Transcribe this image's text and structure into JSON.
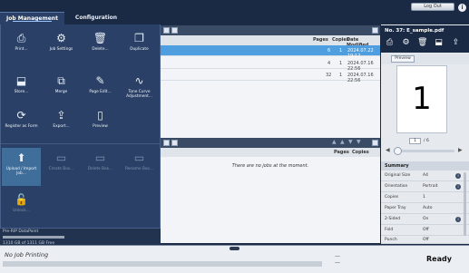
{
  "header": {
    "tabs": [
      {
        "label": "Job Management"
      },
      {
        "label": "Configuration"
      }
    ],
    "logout_label": "Log Out",
    "info_icon": "i"
  },
  "job_list": {
    "columns": {
      "pages": "Pages",
      "copies": "Copies",
      "date_modified": "Date Modified"
    },
    "rows": [
      {
        "pages": "6",
        "copies": "1",
        "date": "2024.07.22 19:12",
        "selected": true
      },
      {
        "pages": "4",
        "copies": "1",
        "date": "2024.07.16 22:56",
        "selected": false
      },
      {
        "pages": "32",
        "copies": "1",
        "date": "2024.07.16 22:56",
        "selected": false
      }
    ],
    "lower_columns": {
      "pages": "Pages",
      "copies": "Copies"
    },
    "empty_message": "There are no jobs at the moment."
  },
  "menu": {
    "items": [
      {
        "label": "Print...",
        "icon": "print-icon",
        "enabled": true
      },
      {
        "label": "Job Settings",
        "icon": "job-settings-icon",
        "enabled": true
      },
      {
        "label": "Delete...",
        "icon": "trash-icon",
        "enabled": true
      },
      {
        "label": "Duplicate",
        "icon": "duplicate-icon",
        "enabled": true
      },
      {
        "label": "Store...",
        "icon": "store-icon",
        "enabled": true
      },
      {
        "label": "Merge",
        "icon": "merge-icon",
        "enabled": true
      },
      {
        "label": "Page Edit...",
        "icon": "page-edit-icon",
        "enabled": true
      },
      {
        "label": "Tone Curve Adjustment...",
        "icon": "tone-curve-icon",
        "enabled": true
      },
      {
        "label": "Register as Form",
        "icon": "register-form-icon",
        "enabled": true
      },
      {
        "label": "Export...",
        "icon": "export-icon",
        "enabled": true
      },
      {
        "label": "Preview",
        "icon": "preview-icon",
        "enabled": true
      },
      {
        "label": "Upload / Import Job...",
        "icon": "upload-icon",
        "enabled": true,
        "active": true
      },
      {
        "label": "Create Box...",
        "icon": "create-box-icon",
        "enabled": false
      },
      {
        "label": "Delete Box...",
        "icon": "delete-box-icon",
        "enabled": false
      },
      {
        "label": "Rename Box...",
        "icon": "rename-box-icon",
        "enabled": false
      },
      {
        "label": "Unlock...",
        "icon": "unlock-icon",
        "enabled": false
      }
    ]
  },
  "storage": {
    "name": "Pre-RIP DataPoint",
    "free": "1310 GB of 1311 GB Free"
  },
  "preview": {
    "title": "No. 37: E_sample.pdf",
    "preview_label": "Preview",
    "page_number": "1",
    "page_total": "/ 6",
    "page_input": "1"
  },
  "summary": {
    "heading": "Summary",
    "rows": [
      {
        "label": "Original Size",
        "value": "A4"
      },
      {
        "label": "Orientation",
        "value": "Portrait"
      },
      {
        "label": "Copies",
        "value": "1"
      },
      {
        "label": "Paper Tray",
        "value": "Auto"
      },
      {
        "label": "2-Sided",
        "value": "On"
      },
      {
        "label": "Fold",
        "value": "Off"
      },
      {
        "label": "Punch",
        "value": "Off"
      }
    ]
  },
  "status": {
    "message": "No Job Printing",
    "state": "Ready",
    "dash1": "—",
    "dash2": "—"
  }
}
